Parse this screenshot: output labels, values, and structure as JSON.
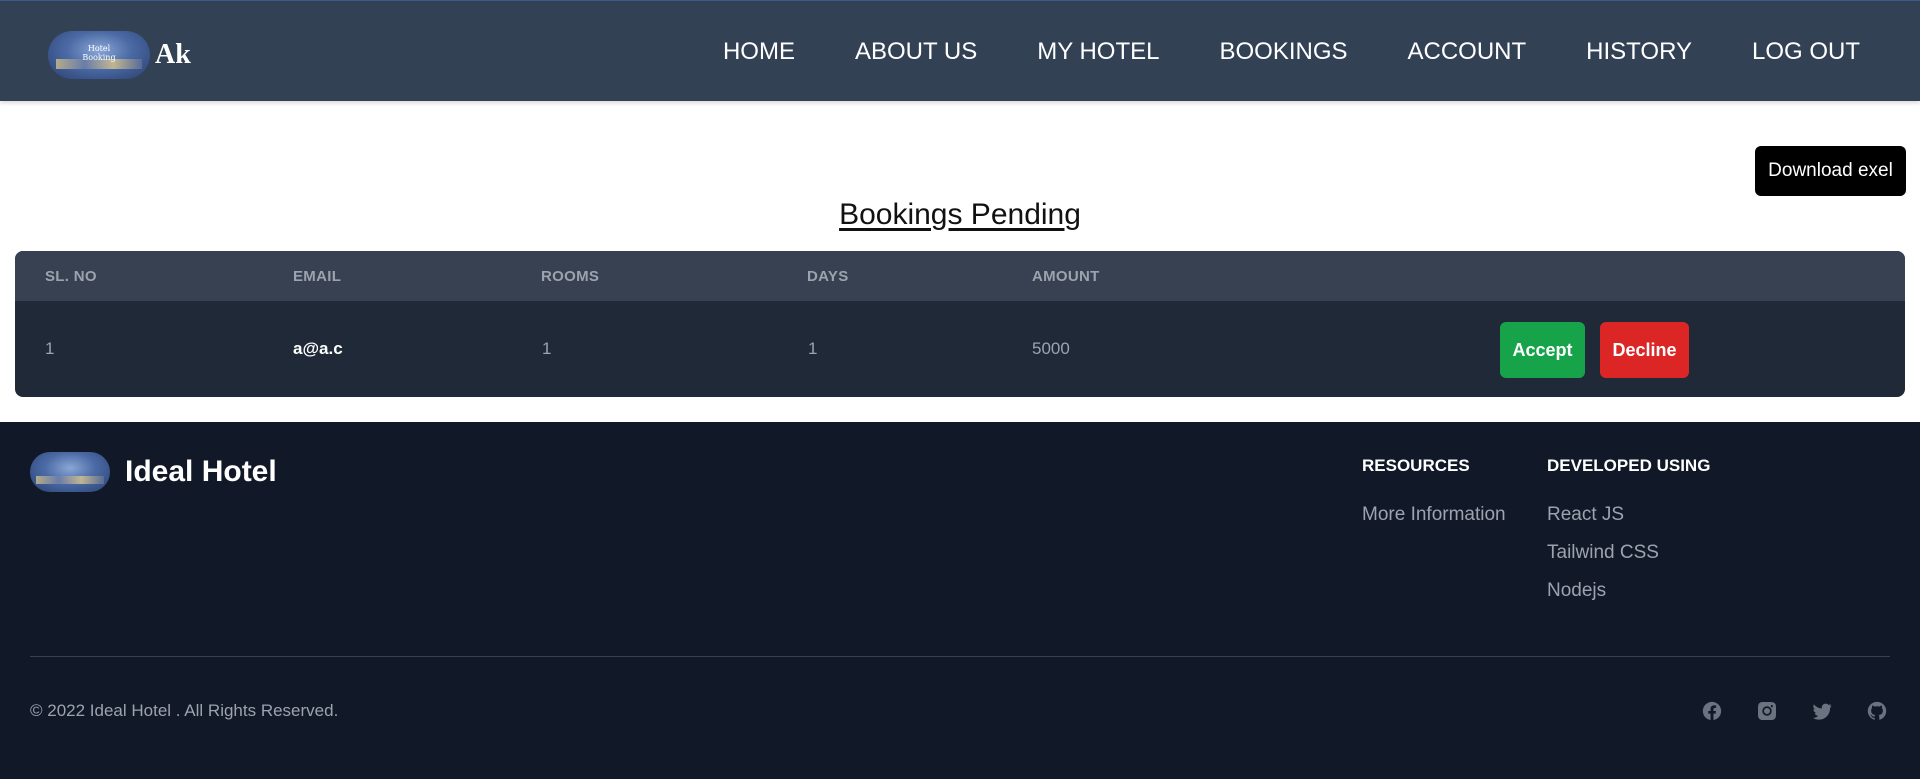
{
  "navbar": {
    "logo_text_line1": "Hotel",
    "logo_text_line2": "Booking",
    "brand_name": "Ak",
    "links": [
      "HOME",
      "ABOUT US",
      "MY HOTEL",
      "BOOKINGS",
      "ACCOUNT",
      "HISTORY",
      "LOG OUT"
    ]
  },
  "main": {
    "download_label": "Download exel",
    "title": "Bookings Pending",
    "columns": [
      "SL. NO",
      "EMAIL",
      "ROOMS",
      "DAYS",
      "AMOUNT"
    ],
    "rows": [
      {
        "sl_no": "1",
        "email": "a@a.c",
        "rooms": "1",
        "days": "1",
        "amount": "5000",
        "accept_label": "Accept",
        "decline_label": "Decline"
      }
    ]
  },
  "footer": {
    "brand_name": "Ideal Hotel",
    "resources_heading": "RESOURCES",
    "resources_links": [
      "More Information"
    ],
    "developed_heading": "DEVELOPED USING",
    "developed_links": [
      "React JS",
      "Tailwind CSS",
      "Nodejs"
    ],
    "copyright": "© 2022 Ideal Hotel . All Rights Reserved.",
    "social_icons": [
      "facebook-icon",
      "instagram-icon",
      "twitter-icon",
      "github-icon"
    ]
  },
  "colors": {
    "navbar_bg": "#334155",
    "table_bg": "#1f2937",
    "table_header_bg": "#374151",
    "accept": "#16a34a",
    "decline": "#dc2626",
    "footer_bg": "#111827"
  }
}
